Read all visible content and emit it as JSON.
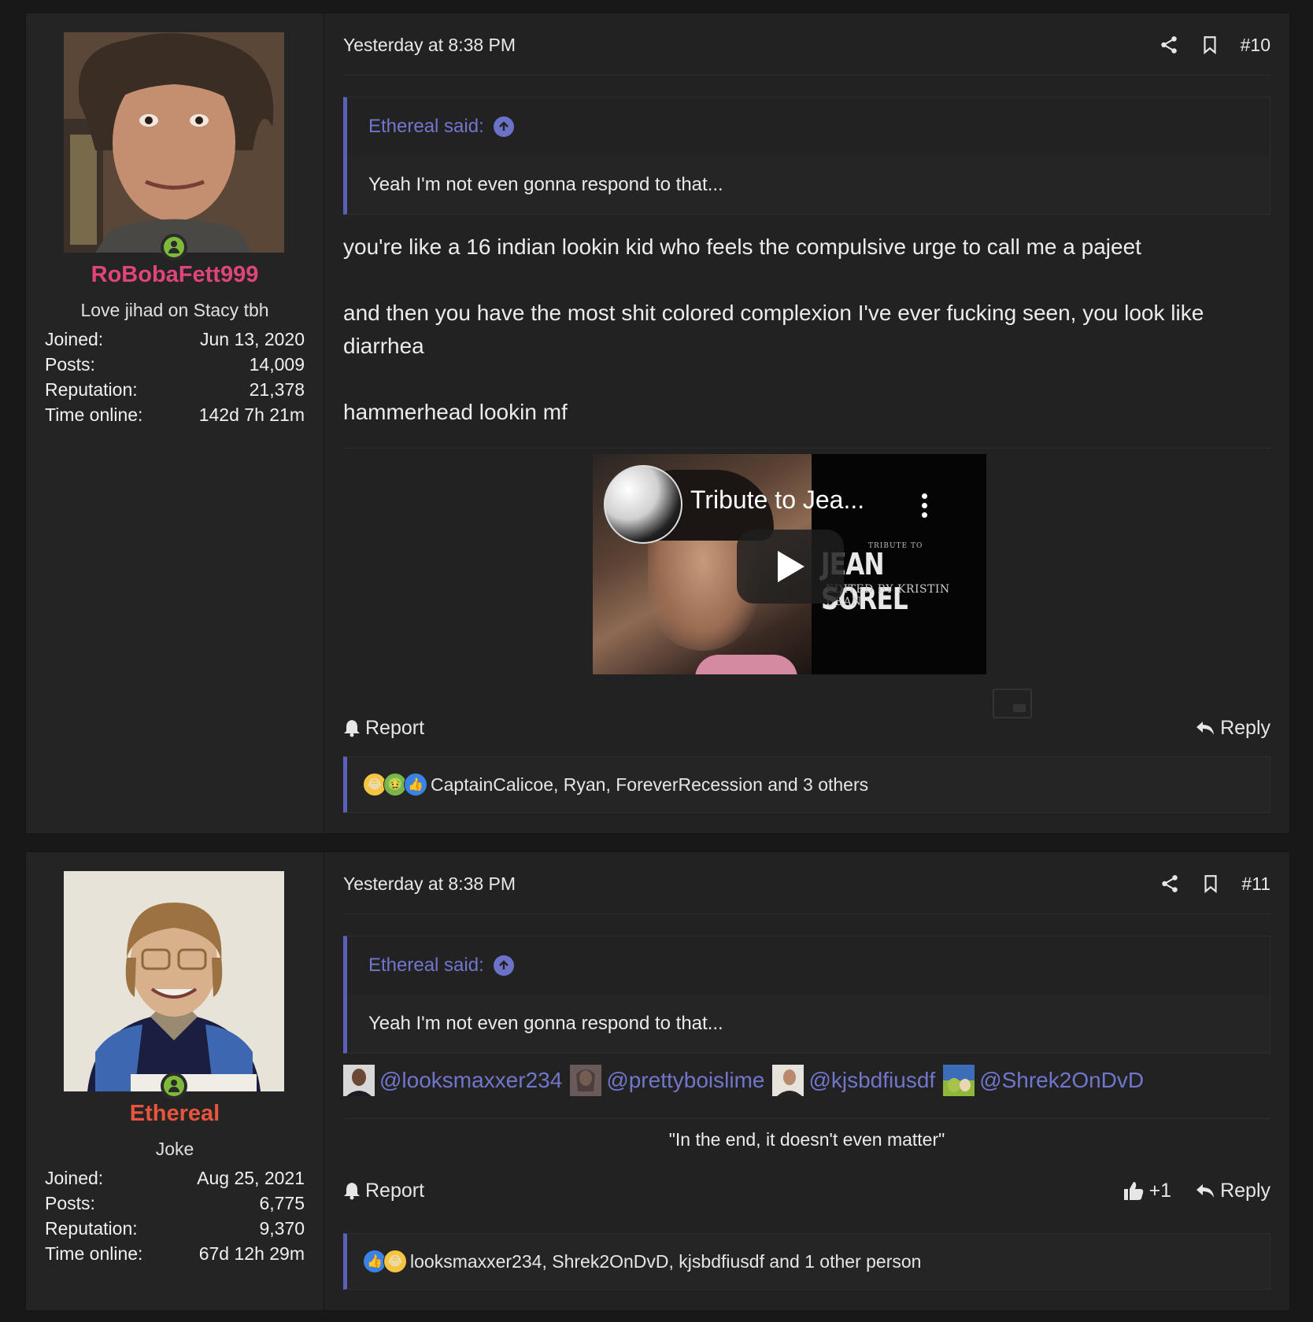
{
  "posts": [
    {
      "user": {
        "name": "RoBobaFett999",
        "name_color": "#e0457a",
        "title": "Love jihad on Stacy tbh",
        "stats": [
          {
            "label": "Joined:",
            "value": "Jun 13, 2020"
          },
          {
            "label": "Posts:",
            "value": "14,009"
          },
          {
            "label": "Reputation:",
            "value": "21,378"
          },
          {
            "label": "Time online:",
            "value": "142d 7h 21m"
          }
        ]
      },
      "timestamp": "Yesterday at 8:38 PM",
      "number": "#10",
      "quote": {
        "author": "Ethereal said:",
        "text": "Yeah I'm not even gonna respond to that..."
      },
      "paragraphs": [
        "you're like a 16 indian lookin kid who feels the compulsive urge to call me a pajeet",
        "and then you have the most shit colored complexion I've ever fucking seen, you look like diarrhea",
        "hammerhead lookin mf"
      ],
      "video": {
        "title": "Tribute to Jea...",
        "overlay_small": "TRIBUTE TO",
        "overlay_big": "JEAN SOREL",
        "overlay_sub": "EDITED BY KRISTIN DEAN"
      },
      "actions": {
        "report": "Report",
        "reply": "Reply"
      },
      "reactions": {
        "icons": [
          "laugh-emoji",
          "sick-emoji",
          "like-emoji"
        ],
        "text": "CaptainCalicoe, Ryan, ForeverRecession and 3 others"
      }
    },
    {
      "user": {
        "name": "Ethereal",
        "name_color": "#e8553e",
        "title": "Joke",
        "stats": [
          {
            "label": "Joined:",
            "value": "Aug 25, 2021"
          },
          {
            "label": "Posts:",
            "value": "6,775"
          },
          {
            "label": "Reputation:",
            "value": "9,370"
          },
          {
            "label": "Time online:",
            "value": "67d 12h 29m"
          }
        ]
      },
      "timestamp": "Yesterday at 8:38 PM",
      "number": "#11",
      "quote": {
        "author": "Ethereal said:",
        "text": "Yeah I'm not even gonna respond to that..."
      },
      "mentions": [
        "@looksmaxxer234",
        "@prettyboislime",
        "@kjsbdfiusdf",
        "@Shrek2OnDvD"
      ],
      "signature": "\"In the end, it doesn't even matter\"",
      "actions": {
        "report": "Report",
        "like": "+1",
        "reply": "Reply"
      },
      "reactions": {
        "icons": [
          "like-emoji",
          "laugh-emoji"
        ],
        "text": "looksmaxxer234, Shrek2OnDvD, kjsbdfiusdf and 1 other person"
      }
    }
  ],
  "colors": {
    "accent": "#5b61b8",
    "link": "#7176cc",
    "background": "#181818",
    "panel": "#222222"
  }
}
